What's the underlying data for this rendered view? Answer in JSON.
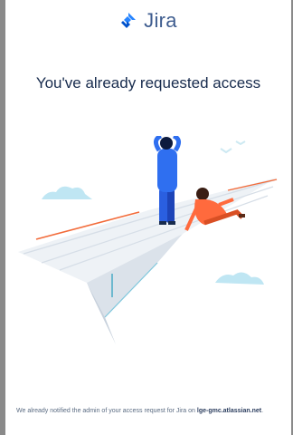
{
  "brand": {
    "name": "Jira",
    "icon": "jira-logo-icon",
    "color": "#2684ff"
  },
  "page": {
    "title": "You've already requested access"
  },
  "illustration": {
    "icon": "paper-plane-people-illustration"
  },
  "footer": {
    "text": "We already notified the admin of your access request for Jira on",
    "site": "lge-gmc.atlassian.net",
    "period": "."
  }
}
